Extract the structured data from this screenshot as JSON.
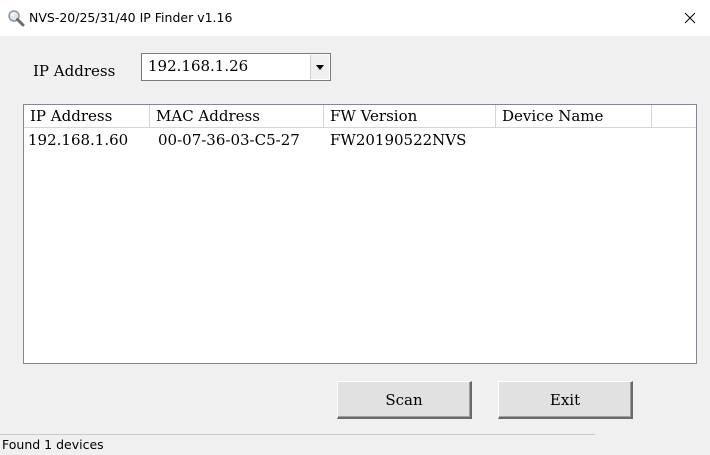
{
  "window": {
    "title": "NVS-20/25/31/40 IP Finder v1.16",
    "close_glyph": "✕"
  },
  "ip_selector": {
    "label": "IP Address",
    "selected": "192.168.1.26"
  },
  "device_list": {
    "columns": [
      "IP Address",
      "MAC Address",
      "FW Version",
      "Device Name"
    ],
    "rows": [
      {
        "ip": "192.168.1.60",
        "mac": "00-07-36-03-C5-27",
        "fw": "FW20190522NVS",
        "name": ""
      }
    ]
  },
  "buttons": {
    "scan_label": "Scan",
    "exit_label": "Exit"
  },
  "status": {
    "text": "Found 1 devices"
  }
}
